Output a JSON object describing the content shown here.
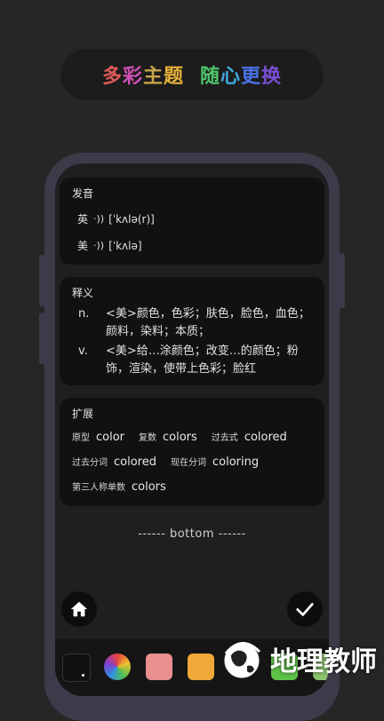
{
  "banner": {
    "part1": [
      "多",
      "彩",
      "主",
      "题"
    ],
    "part2": [
      "随",
      "心",
      "更",
      "换"
    ],
    "colors1": [
      "#e05a5a",
      "#d44fb8",
      "#c9a44a",
      "#e8b23a"
    ],
    "colors2": [
      "#4fc46c",
      "#3fa8e0",
      "#4a72e8",
      "#7a4fd8"
    ]
  },
  "pronunciation": {
    "title": "发音",
    "uk_label": "英",
    "uk_phonetic": "[ˈkʌlə(r)]",
    "us_label": "美",
    "us_phonetic": "[ˈkʌlə]",
    "speaker_glyph": "·))"
  },
  "definition": {
    "title": "释义",
    "items": [
      {
        "pos": "n.",
        "text": "<美>颜色，色彩；肤色，脸色，血色；颜料，染料；本质；"
      },
      {
        "pos": "v.",
        "text": "<美>给…涂颜色；改变…的颜色；粉饰，渲染，使带上色彩；脸红"
      }
    ]
  },
  "expansion": {
    "title": "扩展",
    "rows": [
      [
        {
          "label": "原型",
          "value": "color"
        },
        {
          "label": "复数",
          "value": "colors"
        },
        {
          "label": "过去式",
          "value": "colored"
        }
      ],
      [
        {
          "label": "过去分词",
          "value": "colored"
        },
        {
          "label": "现在分词",
          "value": "coloring"
        }
      ],
      [
        {
          "label": "第三人称单数",
          "value": "colors"
        }
      ]
    ]
  },
  "bottom_text": "------ bottom ------",
  "palette_colors": [
    "#111111",
    "#e88f8f",
    "#f0a83a",
    "#5fc24a",
    "#8dc26f"
  ],
  "watermark": "地理教师"
}
